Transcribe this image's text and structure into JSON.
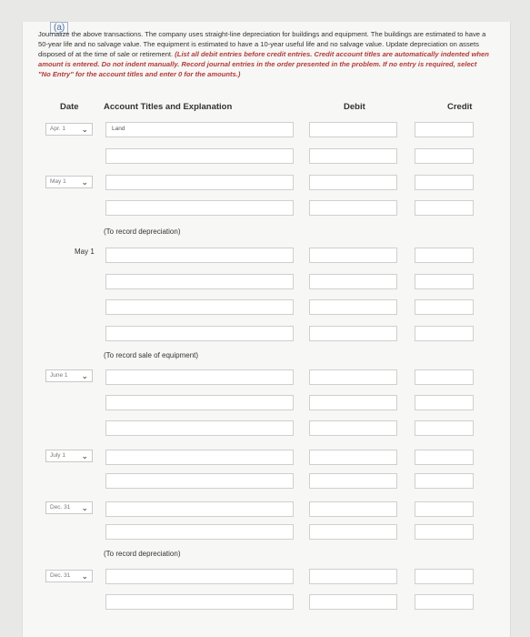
{
  "part_label": "(a)",
  "instructions": {
    "plain": "Journalize the above transactions. The company uses straight-line depreciation for buildings and equipment. The buildings are estimated to have a 50-year life and no salvage value. The equipment is estimated to have a 10-year useful life and no salvage value. Update depreciation on assets disposed of at the time of sale or retirement.",
    "emphasis": "(List all debit entries before credit entries. Credit account titles are automatically indented when amount is entered. Do not indent manually. Record journal entries in the order presented in the problem. If no entry is required, select \"No Entry\" for the account titles and enter 0 for the amounts.)"
  },
  "table_headers": {
    "date": "Date",
    "account": "Account Titles and Explanation",
    "debit": "Debit",
    "credit": "Credit"
  },
  "entries": {
    "apr1": {
      "date": "Apr. 1",
      "account_value": "Land"
    },
    "may1_select": {
      "date": "May 1"
    },
    "may1_static": {
      "date": "May 1"
    },
    "june1": {
      "date": "June 1"
    },
    "july1": {
      "date": "July 1"
    },
    "dec31a": {
      "date": "Dec. 31"
    },
    "dec31b": {
      "date": "Dec. 31"
    }
  },
  "memos": {
    "depreciation_1": "(To record depreciation)",
    "sale_equipment": "(To record sale of equipment)",
    "depreciation_2": "(To record depreciation)"
  }
}
